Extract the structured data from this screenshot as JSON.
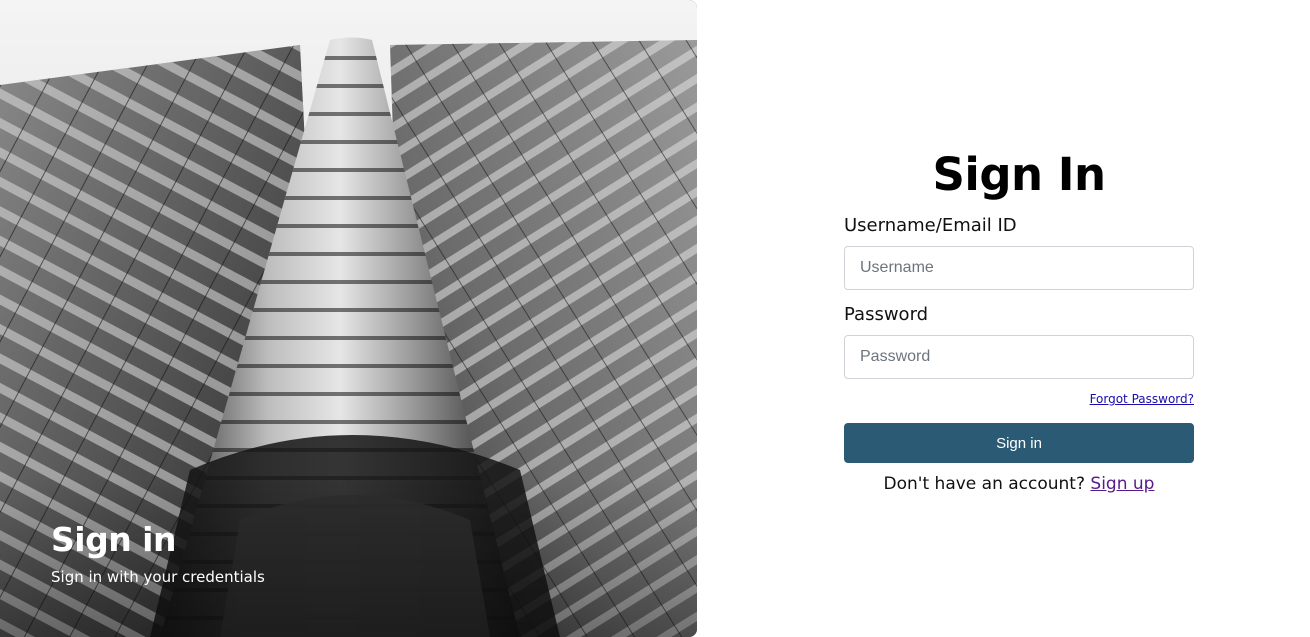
{
  "hero": {
    "title": "Sign in",
    "subtitle": "Sign in with your credentials"
  },
  "form": {
    "title": "Sign In",
    "username_label": "Username/Email ID",
    "username_placeholder": "Username",
    "password_label": "Password",
    "password_placeholder": "Password",
    "forgot_password": "Forgot Password?",
    "submit_label": "Sign in",
    "signup_prompt": "Don't have an account?",
    "signup_link": "Sign up"
  },
  "colors": {
    "button": "#2b5b74",
    "link": "#1a0dab",
    "visited_link": "#551a8b"
  }
}
